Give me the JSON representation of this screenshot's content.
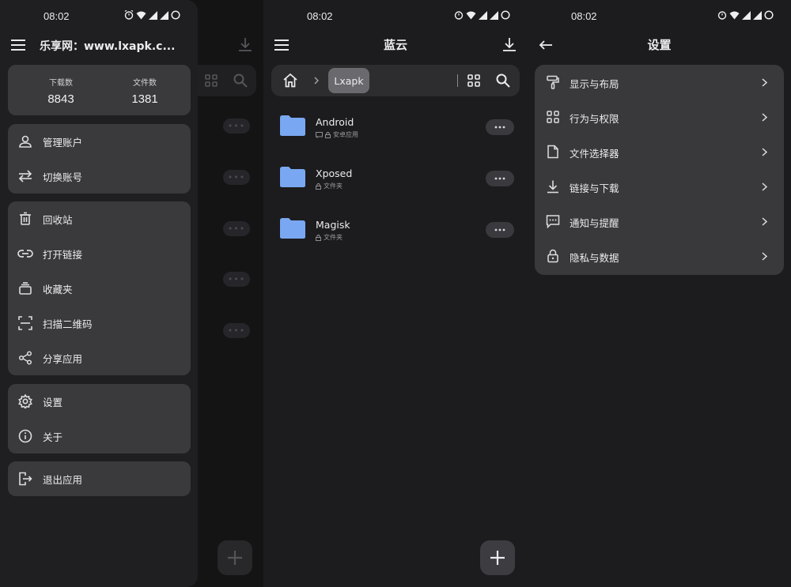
{
  "status_time": "08:02",
  "colors": {
    "accent_folder": "#7aa7f2",
    "card": "#3a3a3d",
    "bg": "#1c1c1e"
  },
  "drawer": {
    "title": "乐享网：www.lxapk.c...",
    "stats": [
      {
        "label": "下载数",
        "value": "8843"
      },
      {
        "label": "文件数",
        "value": "1381"
      }
    ],
    "group1": [
      {
        "label": "管理账户",
        "icon": "person-icon"
      },
      {
        "label": "切换账号",
        "icon": "swap-icon"
      }
    ],
    "group2": [
      {
        "label": "回收站",
        "icon": "trash-icon"
      },
      {
        "label": "打开链接",
        "icon": "link-icon"
      },
      {
        "label": "收藏夹",
        "icon": "collection-icon"
      },
      {
        "label": "扫描二维码",
        "icon": "scan-icon"
      },
      {
        "label": "分享应用",
        "icon": "share-icon"
      }
    ],
    "group3": [
      {
        "label": "设置",
        "icon": "gear-icon"
      },
      {
        "label": "关于",
        "icon": "info-icon"
      }
    ],
    "group4": [
      {
        "label": "退出应用",
        "icon": "exit-icon"
      }
    ]
  },
  "files": {
    "title": "蓝云",
    "path_chip": "Lxapk",
    "items": [
      {
        "name": "Android",
        "meta": "安卓应用"
      },
      {
        "name": "Xposed",
        "meta": "文件夹"
      },
      {
        "name": "Magisk",
        "meta": "文件夹"
      }
    ]
  },
  "settings": {
    "title": "设置",
    "items": [
      {
        "label": "显示与布局",
        "icon": "paint-roller-icon"
      },
      {
        "label": "行为与权限",
        "icon": "grid-icon"
      },
      {
        "label": "文件选择器",
        "icon": "file-icon"
      },
      {
        "label": "链接与下载",
        "icon": "download-icon"
      },
      {
        "label": "通知与提醒",
        "icon": "message-icon"
      },
      {
        "label": "隐私与数据",
        "icon": "lock-icon"
      }
    ]
  }
}
